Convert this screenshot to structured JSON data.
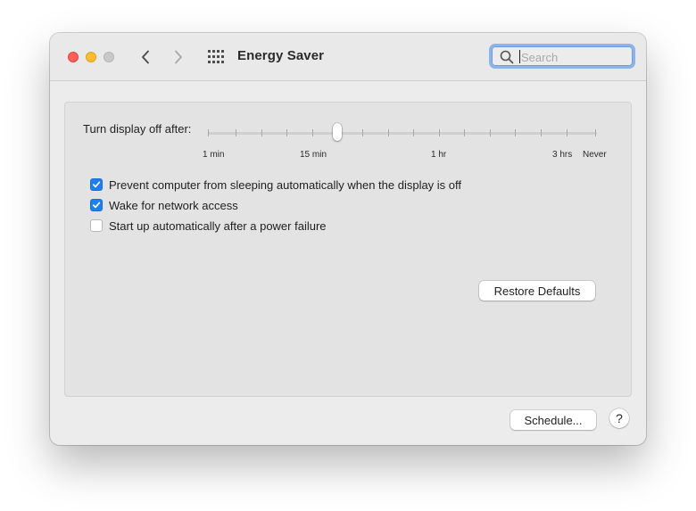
{
  "window": {
    "title": "Energy Saver"
  },
  "toolbar": {
    "back_icon": "chevron-left-icon",
    "forward_icon": "chevron-right-icon",
    "grid_icon": "show-all-grid-icon",
    "search": {
      "placeholder": "Search",
      "value": "",
      "icon": "search-icon"
    }
  },
  "display_sleep": {
    "label": "Turn display off after:",
    "tick_labels": {
      "t1": "1 min",
      "t2": "15 min",
      "t3": "1 hr",
      "t4": "3 hrs",
      "t5": "Never"
    },
    "selected": "15 min"
  },
  "options": [
    {
      "label": "Prevent computer from sleeping automatically when the display is off",
      "checked": true
    },
    {
      "label": "Wake for network access",
      "checked": true
    },
    {
      "label": "Start up automatically after a power failure",
      "checked": false
    }
  ],
  "buttons": {
    "restore_defaults": "Restore Defaults",
    "schedule": "Schedule...",
    "help": "?"
  },
  "colors": {
    "accent": "#1f7ef2",
    "close": "#ff5f57",
    "minimize": "#febc2e",
    "zoom_disabled": "#c9c9c9"
  }
}
